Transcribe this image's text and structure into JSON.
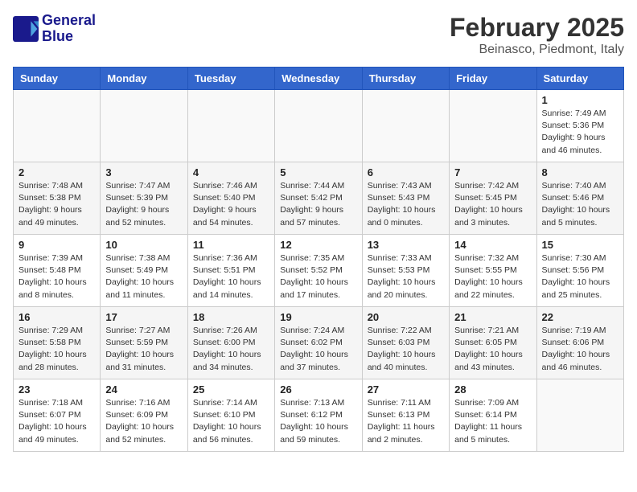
{
  "header": {
    "logo_line1": "General",
    "logo_line2": "Blue",
    "month": "February 2025",
    "location": "Beinasco, Piedmont, Italy"
  },
  "days_of_week": [
    "Sunday",
    "Monday",
    "Tuesday",
    "Wednesday",
    "Thursday",
    "Friday",
    "Saturday"
  ],
  "weeks": [
    [
      {
        "day": "",
        "info": ""
      },
      {
        "day": "",
        "info": ""
      },
      {
        "day": "",
        "info": ""
      },
      {
        "day": "",
        "info": ""
      },
      {
        "day": "",
        "info": ""
      },
      {
        "day": "",
        "info": ""
      },
      {
        "day": "1",
        "info": "Sunrise: 7:49 AM\nSunset: 5:36 PM\nDaylight: 9 hours and 46 minutes."
      }
    ],
    [
      {
        "day": "2",
        "info": "Sunrise: 7:48 AM\nSunset: 5:38 PM\nDaylight: 9 hours and 49 minutes."
      },
      {
        "day": "3",
        "info": "Sunrise: 7:47 AM\nSunset: 5:39 PM\nDaylight: 9 hours and 52 minutes."
      },
      {
        "day": "4",
        "info": "Sunrise: 7:46 AM\nSunset: 5:40 PM\nDaylight: 9 hours and 54 minutes."
      },
      {
        "day": "5",
        "info": "Sunrise: 7:44 AM\nSunset: 5:42 PM\nDaylight: 9 hours and 57 minutes."
      },
      {
        "day": "6",
        "info": "Sunrise: 7:43 AM\nSunset: 5:43 PM\nDaylight: 10 hours and 0 minutes."
      },
      {
        "day": "7",
        "info": "Sunrise: 7:42 AM\nSunset: 5:45 PM\nDaylight: 10 hours and 3 minutes."
      },
      {
        "day": "8",
        "info": "Sunrise: 7:40 AM\nSunset: 5:46 PM\nDaylight: 10 hours and 5 minutes."
      }
    ],
    [
      {
        "day": "9",
        "info": "Sunrise: 7:39 AM\nSunset: 5:48 PM\nDaylight: 10 hours and 8 minutes."
      },
      {
        "day": "10",
        "info": "Sunrise: 7:38 AM\nSunset: 5:49 PM\nDaylight: 10 hours and 11 minutes."
      },
      {
        "day": "11",
        "info": "Sunrise: 7:36 AM\nSunset: 5:51 PM\nDaylight: 10 hours and 14 minutes."
      },
      {
        "day": "12",
        "info": "Sunrise: 7:35 AM\nSunset: 5:52 PM\nDaylight: 10 hours and 17 minutes."
      },
      {
        "day": "13",
        "info": "Sunrise: 7:33 AM\nSunset: 5:53 PM\nDaylight: 10 hours and 20 minutes."
      },
      {
        "day": "14",
        "info": "Sunrise: 7:32 AM\nSunset: 5:55 PM\nDaylight: 10 hours and 22 minutes."
      },
      {
        "day": "15",
        "info": "Sunrise: 7:30 AM\nSunset: 5:56 PM\nDaylight: 10 hours and 25 minutes."
      }
    ],
    [
      {
        "day": "16",
        "info": "Sunrise: 7:29 AM\nSunset: 5:58 PM\nDaylight: 10 hours and 28 minutes."
      },
      {
        "day": "17",
        "info": "Sunrise: 7:27 AM\nSunset: 5:59 PM\nDaylight: 10 hours and 31 minutes."
      },
      {
        "day": "18",
        "info": "Sunrise: 7:26 AM\nSunset: 6:00 PM\nDaylight: 10 hours and 34 minutes."
      },
      {
        "day": "19",
        "info": "Sunrise: 7:24 AM\nSunset: 6:02 PM\nDaylight: 10 hours and 37 minutes."
      },
      {
        "day": "20",
        "info": "Sunrise: 7:22 AM\nSunset: 6:03 PM\nDaylight: 10 hours and 40 minutes."
      },
      {
        "day": "21",
        "info": "Sunrise: 7:21 AM\nSunset: 6:05 PM\nDaylight: 10 hours and 43 minutes."
      },
      {
        "day": "22",
        "info": "Sunrise: 7:19 AM\nSunset: 6:06 PM\nDaylight: 10 hours and 46 minutes."
      }
    ],
    [
      {
        "day": "23",
        "info": "Sunrise: 7:18 AM\nSunset: 6:07 PM\nDaylight: 10 hours and 49 minutes."
      },
      {
        "day": "24",
        "info": "Sunrise: 7:16 AM\nSunset: 6:09 PM\nDaylight: 10 hours and 52 minutes."
      },
      {
        "day": "25",
        "info": "Sunrise: 7:14 AM\nSunset: 6:10 PM\nDaylight: 10 hours and 56 minutes."
      },
      {
        "day": "26",
        "info": "Sunrise: 7:13 AM\nSunset: 6:12 PM\nDaylight: 10 hours and 59 minutes."
      },
      {
        "day": "27",
        "info": "Sunrise: 7:11 AM\nSunset: 6:13 PM\nDaylight: 11 hours and 2 minutes."
      },
      {
        "day": "28",
        "info": "Sunrise: 7:09 AM\nSunset: 6:14 PM\nDaylight: 11 hours and 5 minutes."
      },
      {
        "day": "",
        "info": ""
      }
    ]
  ]
}
